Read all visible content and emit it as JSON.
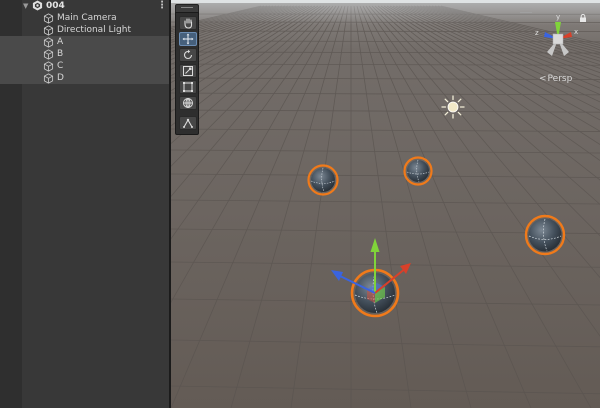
{
  "hierarchy": {
    "scene_name": "004",
    "scene_expand_icon": "triangle-down-icon",
    "scene_icon": "unity-scene-icon",
    "menu_icon": "kebab-menu-icon",
    "items": [
      {
        "label": "Main Camera",
        "icon": "gameobject-cube-icon",
        "selected": false
      },
      {
        "label": "Directional Light",
        "icon": "gameobject-cube-icon",
        "selected": false
      },
      {
        "label": "A",
        "icon": "gameobject-cube-icon",
        "selected": true
      },
      {
        "label": "B",
        "icon": "gameobject-cube-icon",
        "selected": true
      },
      {
        "label": "C",
        "icon": "gameobject-cube-icon",
        "selected": true
      },
      {
        "label": "D",
        "icon": "gameobject-cube-icon",
        "selected": true
      }
    ]
  },
  "scene_view": {
    "tools": [
      {
        "name": "view-tool",
        "icon": "hand-icon",
        "active": false
      },
      {
        "name": "move-tool",
        "icon": "move-arrows-icon",
        "active": true
      },
      {
        "name": "rotate-tool",
        "icon": "rotate-icon",
        "active": false
      },
      {
        "name": "scale-tool",
        "icon": "scale-icon",
        "active": false
      },
      {
        "name": "rect-tool",
        "icon": "rect-transform-icon",
        "active": false
      },
      {
        "name": "transform-tool",
        "icon": "transform-icon",
        "active": false
      },
      {
        "name": "custom-tool",
        "icon": "custom-tool-icon",
        "active": false
      }
    ],
    "gizmo_axes": {
      "y": "y",
      "x": "x",
      "z": "z"
    },
    "projection_label": "Persp",
    "projection_arrow": "<",
    "colors": {
      "selection_outline": "#f07a1a",
      "axis_x": "#d8402a",
      "axis_y": "#7fd83a",
      "axis_z": "#3a64e0",
      "grid_background": "#6c6560"
    }
  }
}
